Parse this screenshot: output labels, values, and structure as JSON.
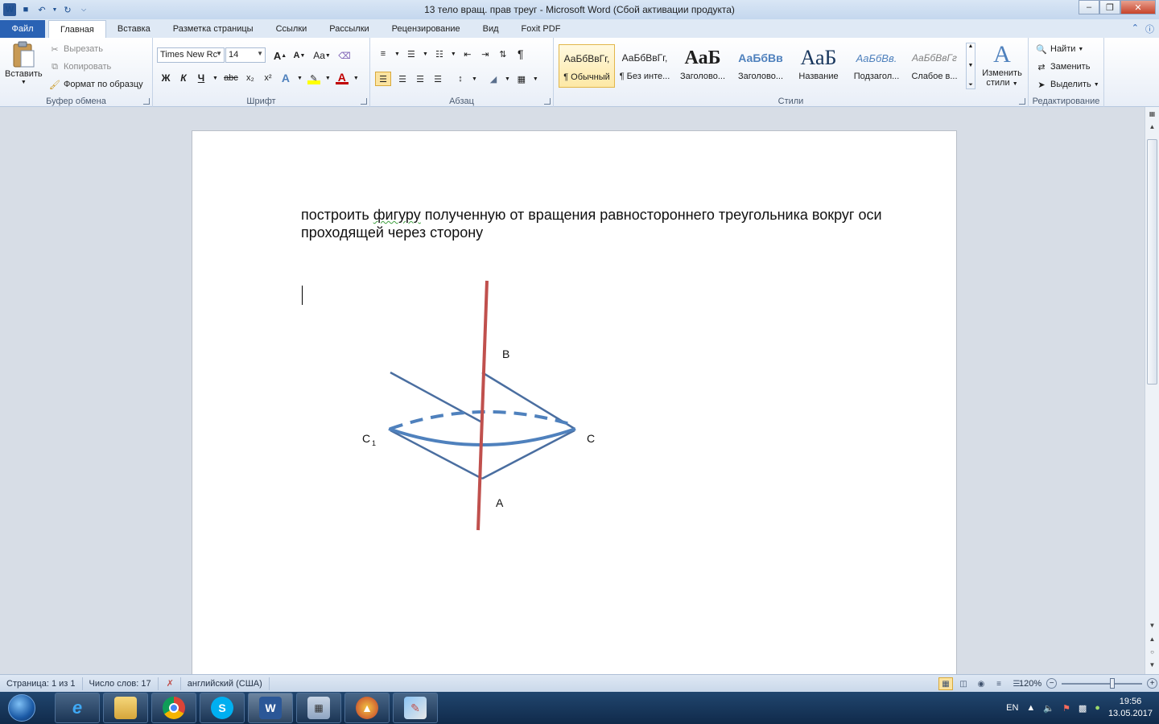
{
  "window": {
    "title": "13 тело вращ. прав треуг  -  Microsoft Word (Сбой активации продукта)",
    "qat_logo": "W"
  },
  "tabs": {
    "file": "Файл",
    "items": [
      "Главная",
      "Вставка",
      "Разметка страницы",
      "Ссылки",
      "Рассылки",
      "Рецензирование",
      "Вид",
      "Foxit PDF"
    ]
  },
  "ribbon": {
    "clipboard": {
      "paste": "Вставить",
      "cut": "Вырезать",
      "copy": "Копировать",
      "format_painter": "Формат по образцу",
      "label": "Буфер обмена"
    },
    "font": {
      "font_name": "Times New Rc",
      "font_size": "14",
      "label": "Шрифт",
      "bold": "Ж",
      "italic": "К",
      "underline": "Ч",
      "strike": "abc",
      "subscript": "x₂",
      "superscript": "x²",
      "grow": "A",
      "shrink": "A",
      "case": "Aa"
    },
    "paragraph": {
      "label": "Абзац"
    },
    "styles": {
      "label": "Стили",
      "items": [
        {
          "sample": "АаБбВвГг,",
          "name": "¶ Обычный"
        },
        {
          "sample": "АаБбВвГг,",
          "name": "¶ Без инте..."
        },
        {
          "sample": "АаБ",
          "name": "Заголово..."
        },
        {
          "sample": "АаБбВв",
          "name": "Заголово..."
        },
        {
          "sample": "АаБ",
          "name": "Название"
        },
        {
          "sample": "АаБбВв.",
          "name": "Подзагол..."
        },
        {
          "sample": "АаБбВвГг",
          "name": "Слабое в..."
        }
      ],
      "change_styles_1": "Изменить",
      "change_styles_2": "стили"
    },
    "editing": {
      "label": "Редактирование",
      "find": "Найти",
      "replace": "Заменить",
      "select": "Выделить"
    }
  },
  "document": {
    "text_before": "построить ",
    "text_misspelled": "фигуру",
    "text_after": " полученную от вращения равностороннего треугольника вокруг оси проходящей через сторону",
    "figure_labels": {
      "B": "В",
      "C": "С",
      "A": "А",
      "C1": "С",
      "C1_sub": "1"
    }
  },
  "statusbar": {
    "page": "Страница: 1 из 1",
    "words": "Число слов: 17",
    "language": "английский (США)",
    "zoom": "120%"
  },
  "taskbar": {
    "lang": "EN",
    "time": "19:56",
    "date": "13.05.2017"
  },
  "colors": {
    "axis_red": "#c0504d",
    "cone_blue": "#4a6ea0",
    "ellipse_blue": "#4f81bd"
  }
}
